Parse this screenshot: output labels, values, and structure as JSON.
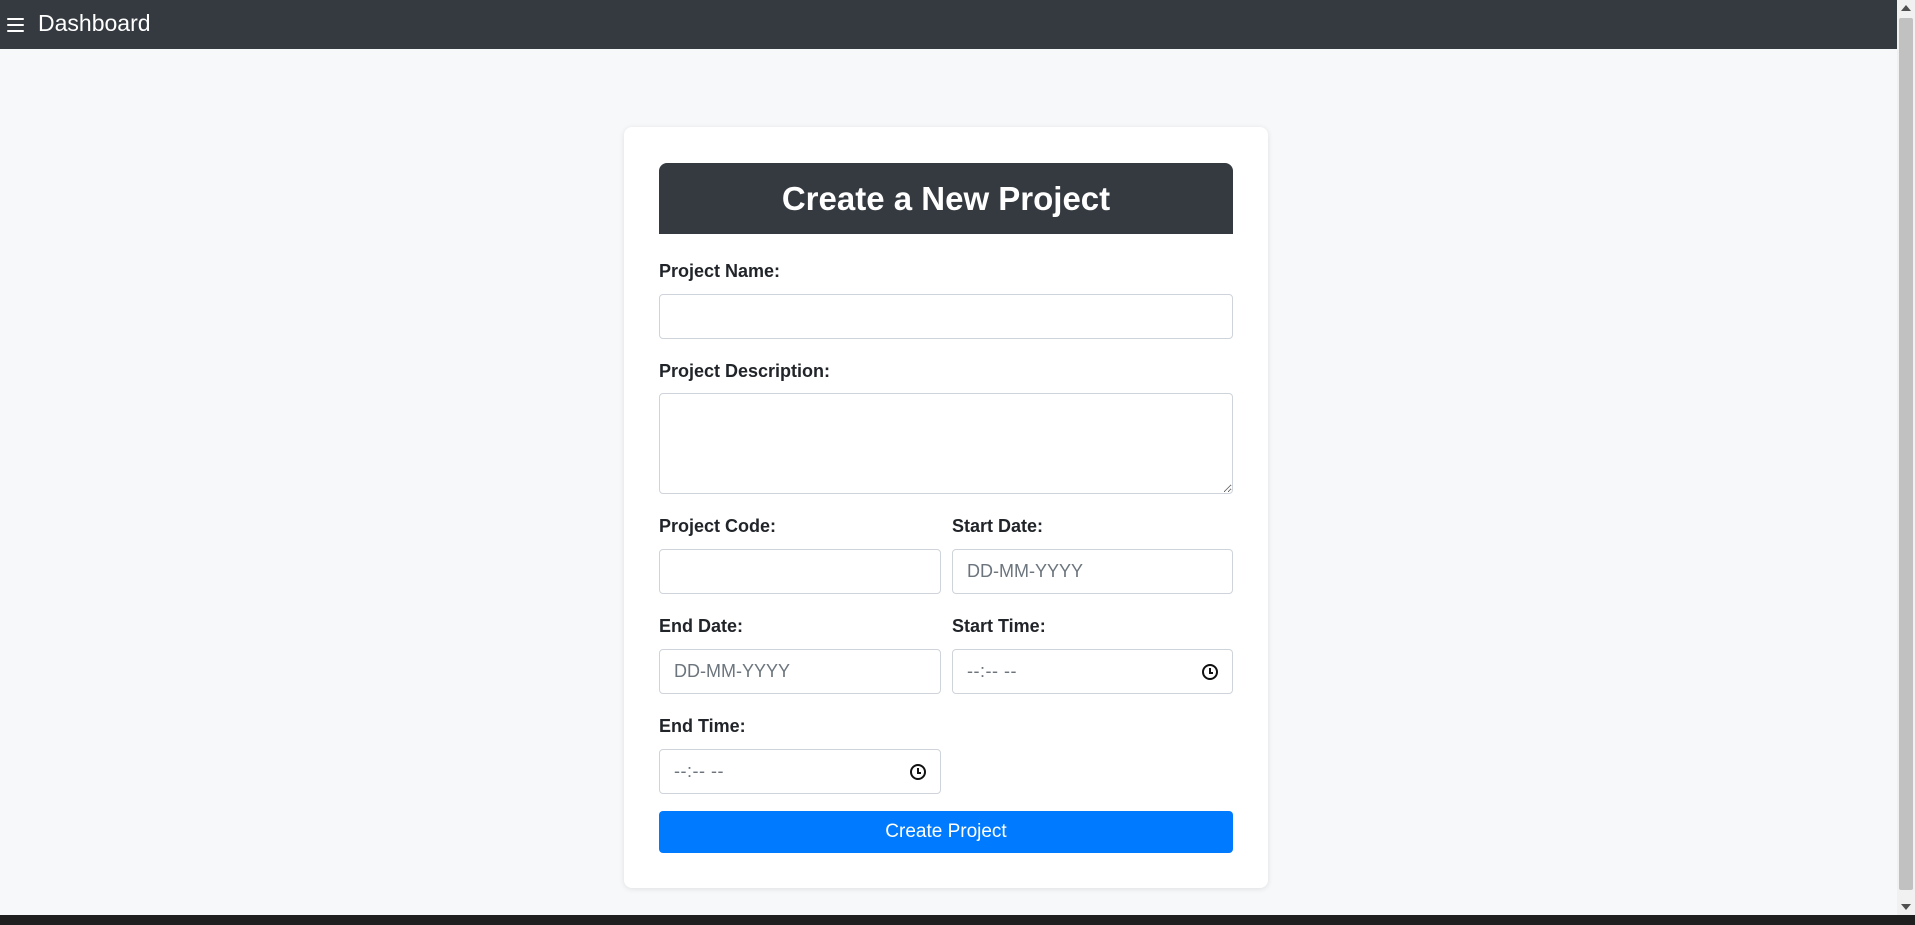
{
  "topbar": {
    "menu_icon": "hamburger-menu-icon",
    "title": "Dashboard"
  },
  "form": {
    "heading": "Create a New Project",
    "project_name": {
      "label": "Project Name:",
      "value": ""
    },
    "project_description": {
      "label": "Project Description:",
      "value": ""
    },
    "project_code": {
      "label": "Project Code:",
      "value": ""
    },
    "start_date": {
      "label": "Start Date:",
      "placeholder": "DD-MM-YYYY"
    },
    "end_date": {
      "label": "End Date:",
      "placeholder": "DD-MM-YYYY"
    },
    "start_time": {
      "label": "Start Time:",
      "placeholder": "--:-- --",
      "icon": "clock-icon"
    },
    "end_time": {
      "label": "End Time:",
      "placeholder": "--:-- --",
      "icon": "clock-icon"
    },
    "submit_label": "Create Project"
  },
  "colors": {
    "topbar_bg": "#343a40",
    "header_bg": "#343a40",
    "button_bg": "#007bff",
    "page_bg": "#f7f8fa"
  }
}
